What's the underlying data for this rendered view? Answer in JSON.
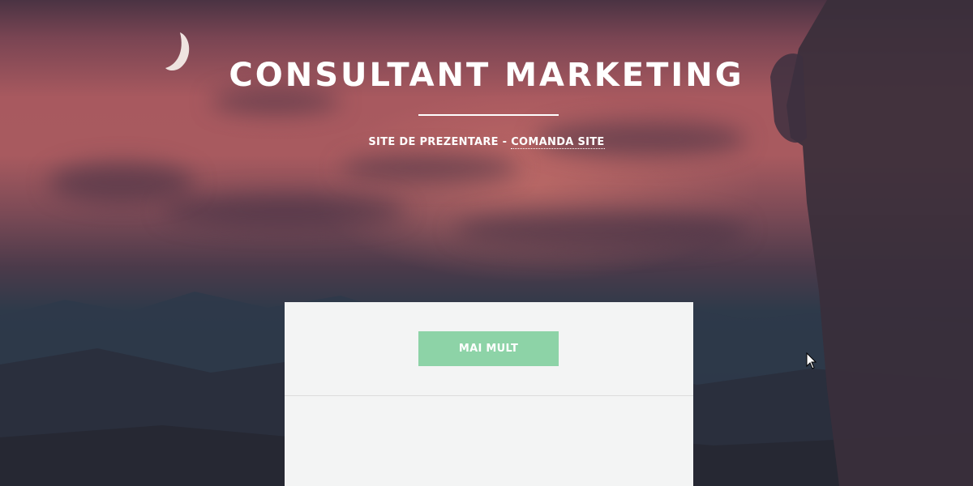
{
  "hero": {
    "title": "CONSULTANT MARKETING",
    "subtitle": {
      "prefix": "SITE DE PREZENTARE - ",
      "link_label": "COMANDA SITE"
    }
  },
  "panel": {
    "button_label": "MAI MULT"
  },
  "colors": {
    "button": "#8dd3a7",
    "panel": "#f3f4f4",
    "text": "#ffffff"
  },
  "icons": {
    "moon": "moon-icon",
    "cursor": "mouse-cursor-icon"
  }
}
